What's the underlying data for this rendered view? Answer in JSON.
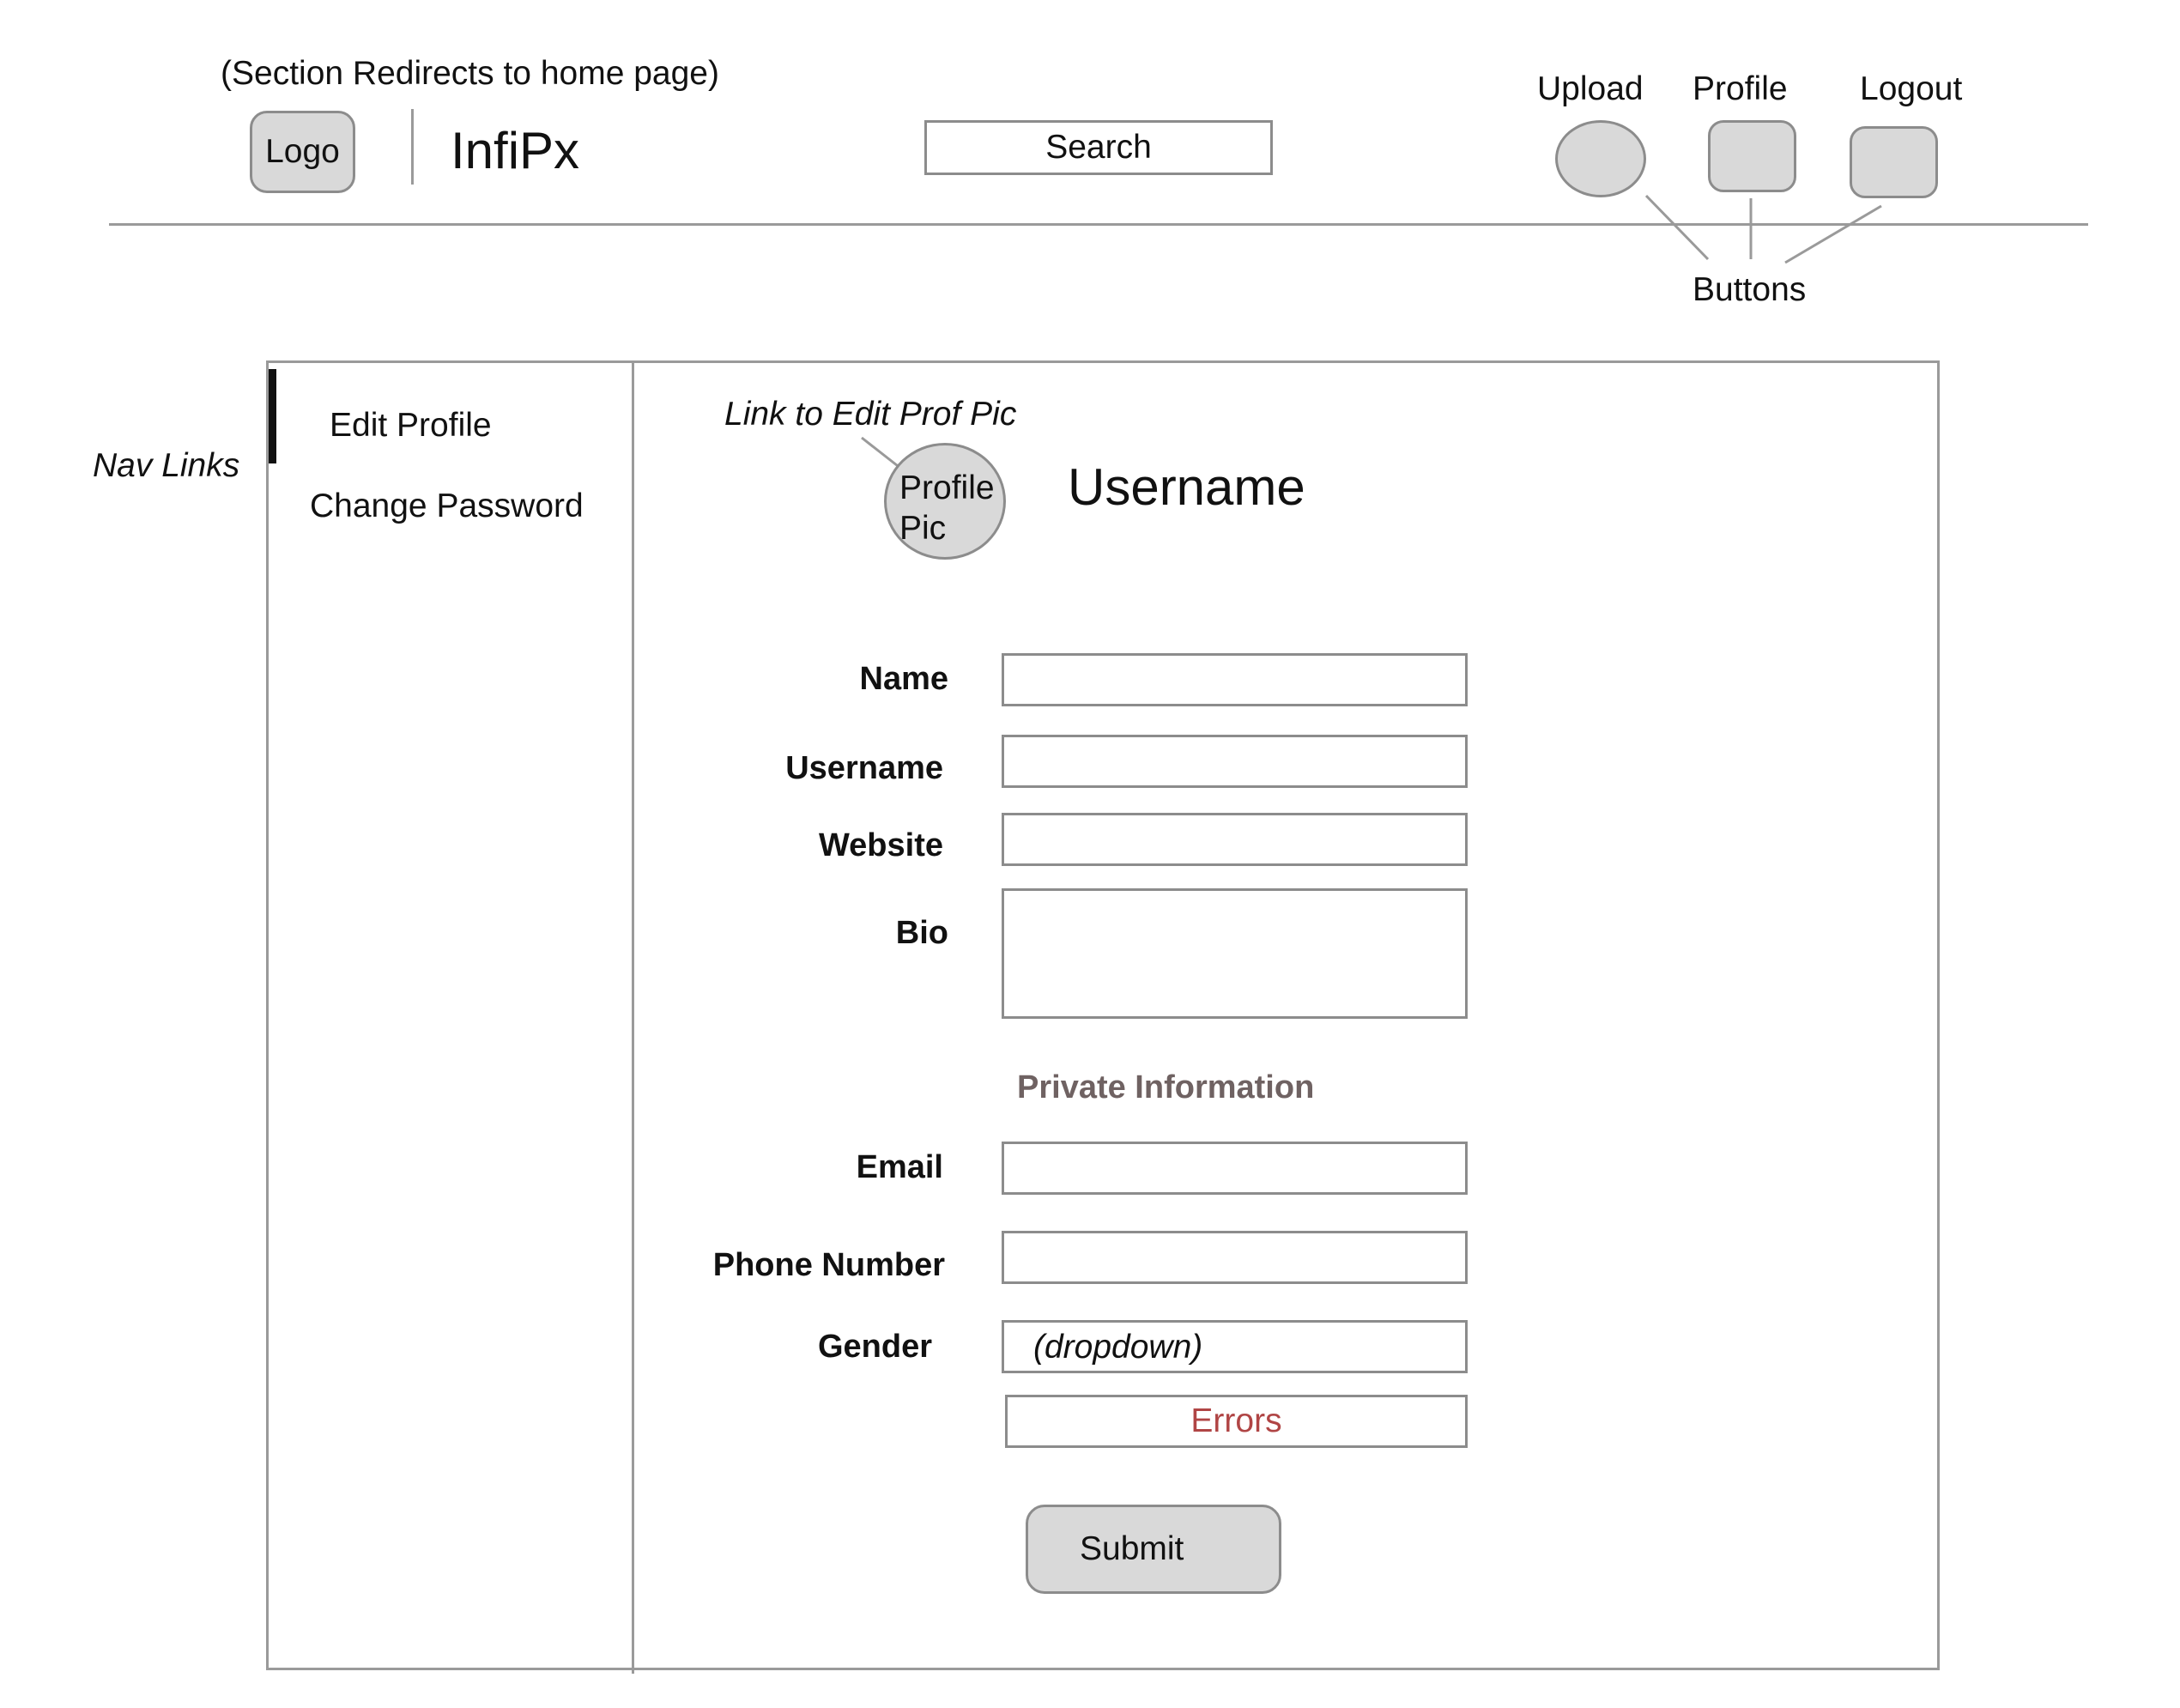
{
  "header": {
    "annotation": "(Section Redirects to home page)",
    "logo_label": "Logo",
    "brand": "InfiPx",
    "search_label": "Search",
    "buttons": {
      "upload": "Upload",
      "profile": "Profile",
      "logout": "Logout",
      "group_label": "Buttons"
    }
  },
  "sidebar": {
    "annotation": "Nav Links",
    "items": [
      {
        "label": "Edit Profile",
        "active": true
      },
      {
        "label": "Change Password",
        "active": false
      }
    ]
  },
  "profile": {
    "pic_annotation": "Link to Edit Prof Pic",
    "pic_text_line1": "Profile",
    "pic_text_line2": "Pic",
    "username": "Username"
  },
  "form": {
    "name_label": "Name",
    "username_label": "Username",
    "website_label": "Website",
    "bio_label": "Bio",
    "private_heading": "Private Information",
    "email_label": "Email",
    "phone_label": "Phone Number",
    "gender_label": "Gender",
    "gender_value": "(dropdown)",
    "errors_text": "Errors",
    "submit_label": "Submit"
  },
  "colors": {
    "control_fill": "#d9d9d9",
    "outline": "#8c8c8c",
    "section_heading": "#6f6262",
    "error_text": "#b04545"
  }
}
